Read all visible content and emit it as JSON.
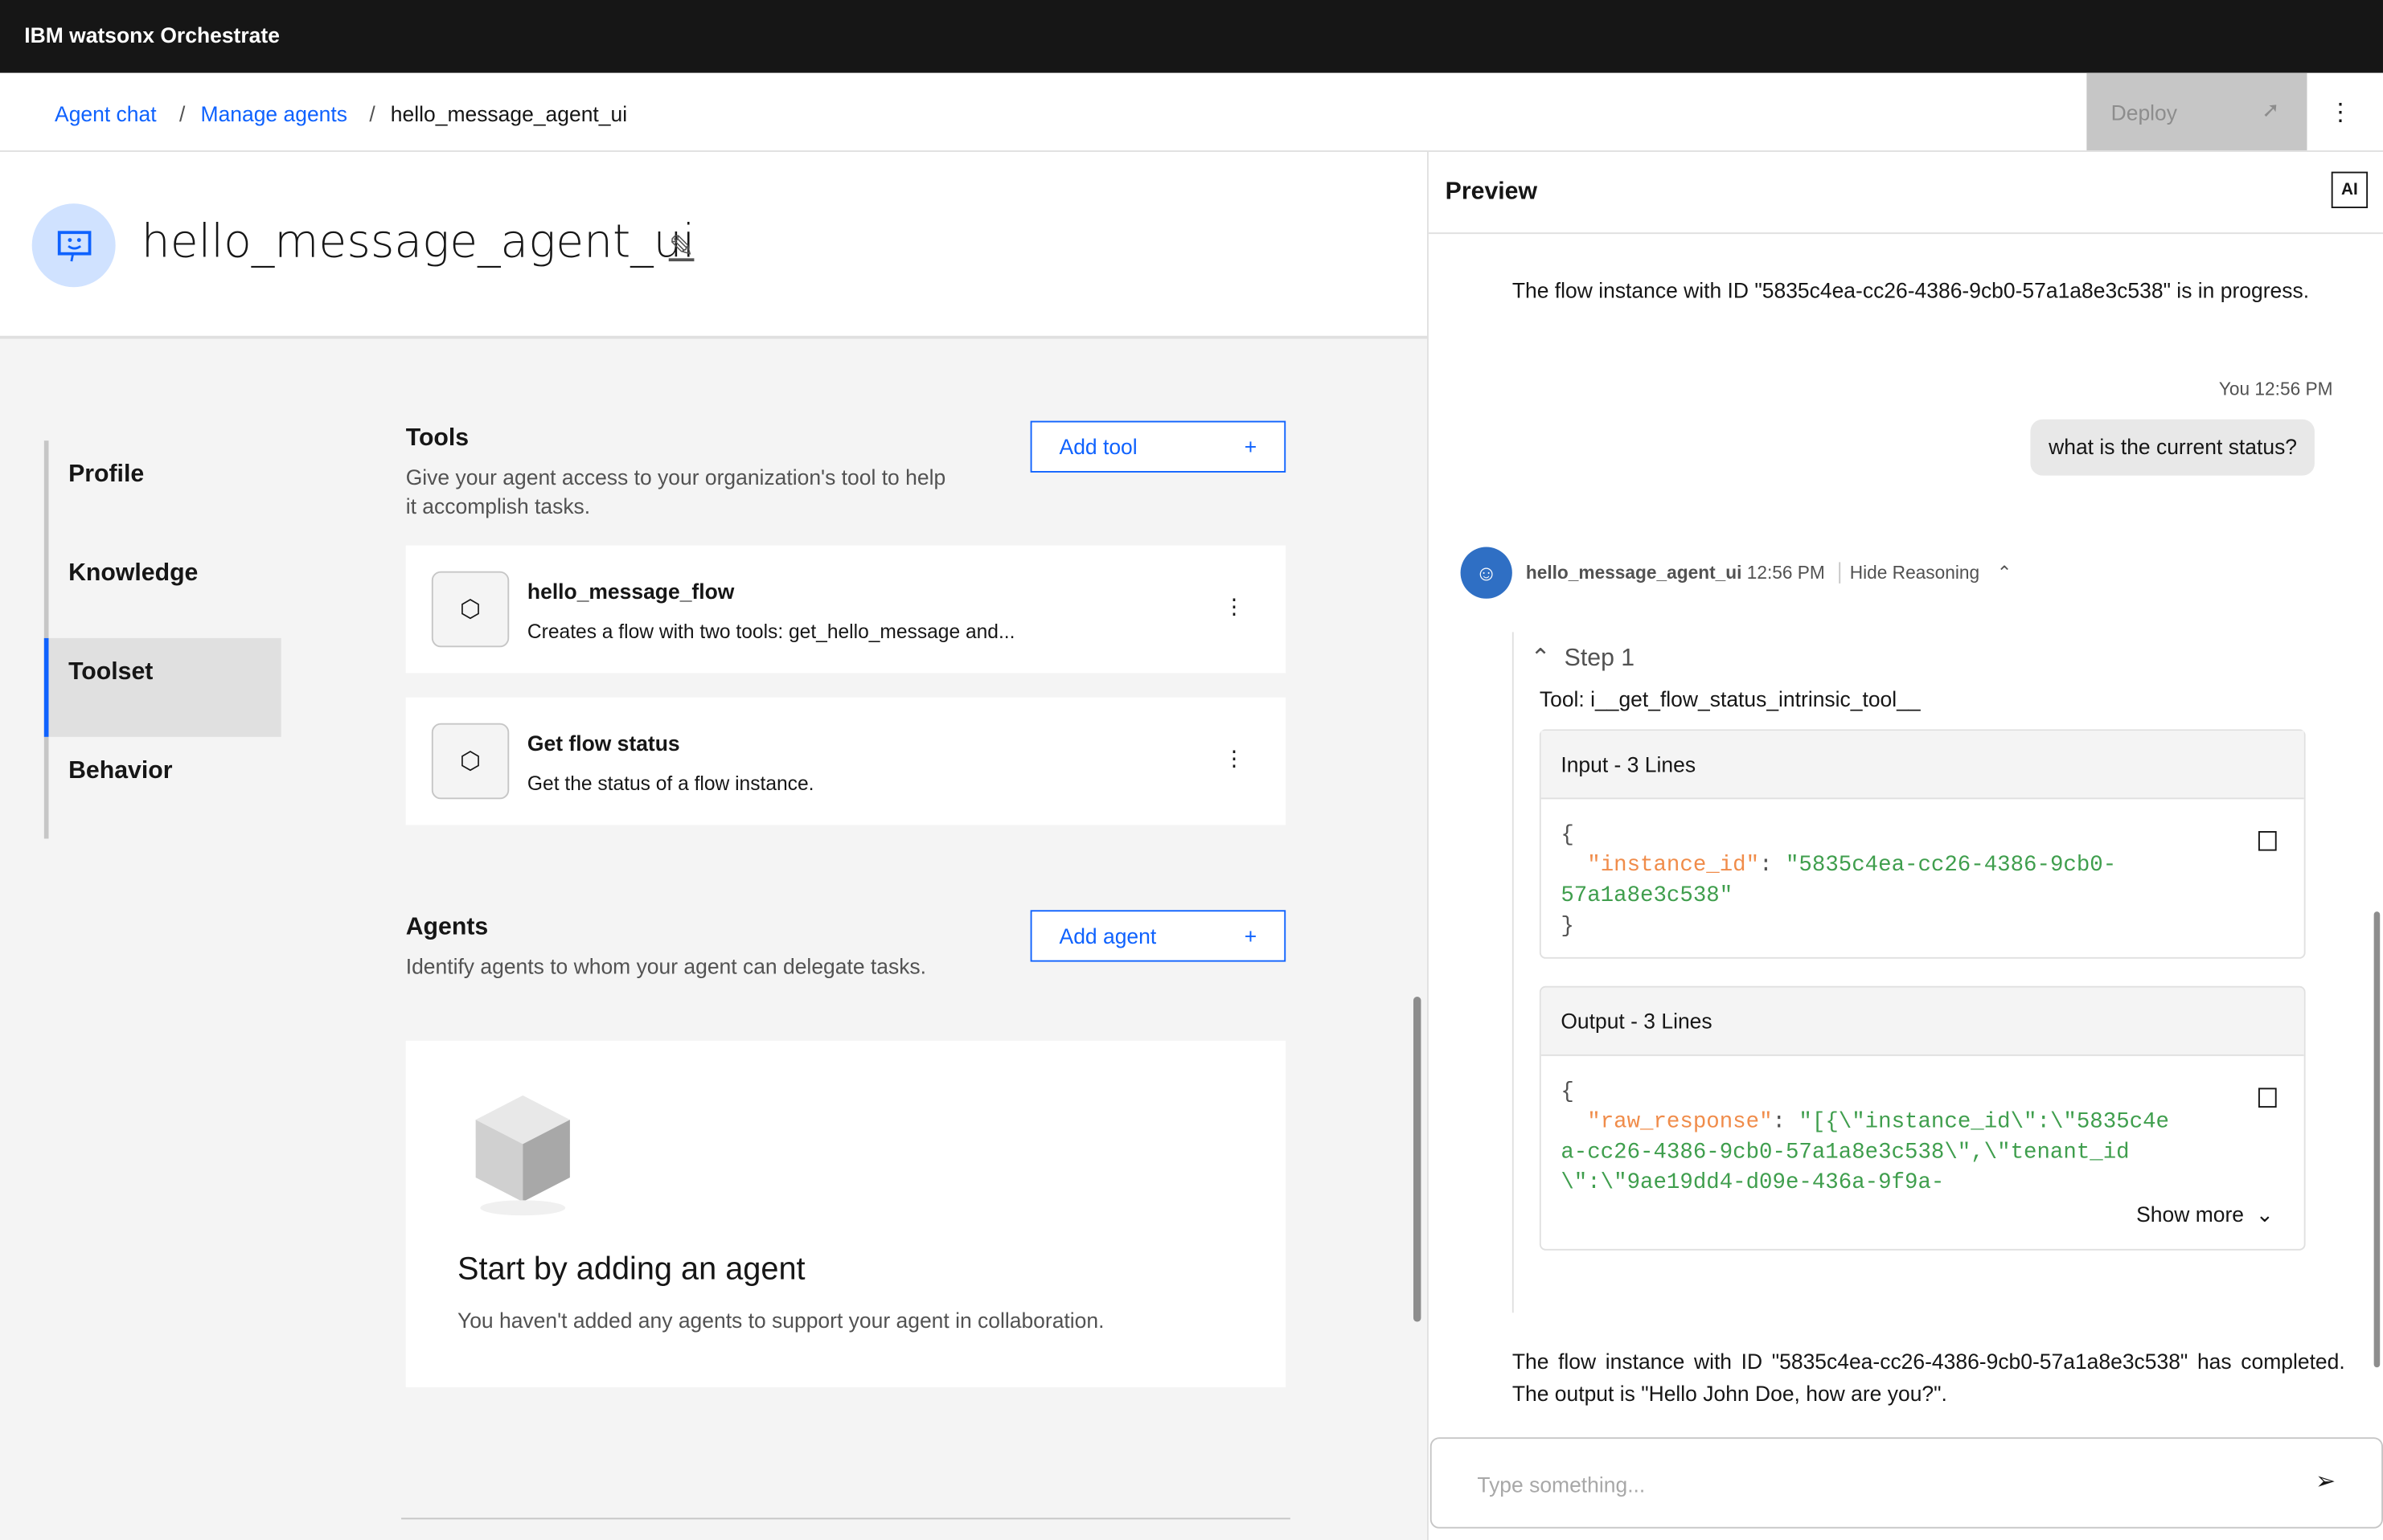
{
  "app": {
    "title": "IBM watsonx Orchestrate"
  },
  "breadcrumb": [
    "Agent chat",
    "Manage agents",
    "hello_message_agent_ui"
  ],
  "header": {
    "deploy": "Deploy",
    "agent_name": "hello_message_agent_ui"
  },
  "sidebar": {
    "items": [
      {
        "label": "Profile"
      },
      {
        "label": "Knowledge"
      },
      {
        "label": "Toolset",
        "selected": true
      },
      {
        "label": "Behavior"
      }
    ]
  },
  "tools": {
    "title": "Tools",
    "description": "Give your agent access to your organization's tool to help it accomplish tasks.",
    "add_label": "Add tool",
    "items": [
      {
        "name": "hello_message_flow",
        "description": "Creates a flow with two tools: get_hello_message and..."
      },
      {
        "name": "Get flow status",
        "description": "Get the status of a flow instance."
      }
    ]
  },
  "agents": {
    "title": "Agents",
    "description": "Identify agents to whom your agent can delegate tasks.",
    "add_label": "Add agent",
    "empty_title": "Start by adding an agent",
    "empty_text": "You haven't added any agents to support your agent in collaboration."
  },
  "preview": {
    "title": "Preview",
    "ai_label": "AI",
    "msg1": "The flow instance with ID \"5835c4ea-cc26-4386-9cb0-57a1a8e3c538\" is in progress.",
    "user_meta": "You 12:56 PM",
    "user_msg": "what is the current status?",
    "agent_name": "hello_message_agent_ui",
    "agent_time": "12:56 PM",
    "hide_reasoning": "Hide Reasoning",
    "step": "Step 1",
    "tool": "Tool: i__get_flow_status_intrinsic_tool__",
    "input_title": "Input - 3 Lines",
    "input_key": "\"instance_id\"",
    "input_val": "\"5835c4ea-cc26-4386-9cb0-57a1a8e3c538\"",
    "output_title": "Output - 3 Lines",
    "output_key": "\"raw_response\"",
    "output_val": "\"[{\\\"instance_id\\\":\\\"5835c4ea-cc26-4386-9cb0-57a1a8e3c538\\\",\\\"tenant_id\\\":\\\"9ae19dd4-d09e-436a-9f9a-",
    "show_more": "Show more",
    "msg2": "The flow instance with ID \"5835c4ea-cc26-4386-9cb0-57a1a8e3c538\" has completed. The output is \"Hello John Doe, how are you?\".",
    "input_placeholder": "Type something..."
  },
  "colors": {
    "accent": "#0f62fe",
    "topbar": "#161616",
    "code_key": "#f08c4a",
    "code_string": "#3f9e4d"
  }
}
